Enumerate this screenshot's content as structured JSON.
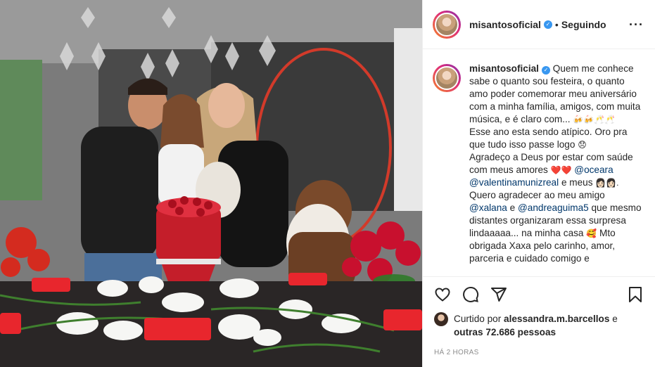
{
  "post": {
    "username": "misantosoficial",
    "follow_separator": "•",
    "follow_status": "Seguindo",
    "more_icon": "more-horizontal-icon",
    "verified_icon": "verified-badge-icon"
  },
  "caption": {
    "username": "misantosoficial",
    "line1": "Quem me conhece sabe o quanto sou festeira, o quanto amo poder comemorar meu aniversário com a minha família, amigos, com muita música, e é claro com...",
    "line1_emojis": "🍻🍻🥂🥂",
    "line2": "Esse ano esta sendo atípico. Oro pra que tudo isso passe logo",
    "line2_emoji": "😞",
    "line3_a": "Agradeço a Deus por estar com saúde com meus amores",
    "line3_emojis": "❤️❤️",
    "mention1": "@oceara",
    "mention2": "@valentinamunizreal",
    "line3_b": "e meus",
    "line3_emojis2": "👩🏻👩🏻.",
    "line4_a": "Quero agradecer ao meu amigo",
    "mention3": "@xalana",
    "line4_e": "e",
    "mention4": "@andreaguima5",
    "line4_b": "que mesmo distantes organizaram essa surpresa lindaaaaa... na minha casa",
    "line4_emoji": "🥰",
    "line5": "Mto obrigada Xaxa pelo carinho, amor, parceria e cuidado comigo e"
  },
  "actions": {
    "like_icon": "heart-icon",
    "comment_icon": "comment-icon",
    "share_icon": "share-icon",
    "save_icon": "bookmark-icon"
  },
  "likes": {
    "prefix": "Curtido por",
    "user": "alessandra.m.barcellos",
    "mid": "e",
    "others": "outras 72.686 pessoas"
  },
  "timestamp": "HÁ 2 HORAS",
  "colors": {
    "accent_link": "#00376b",
    "verified": "#3897f0",
    "muted": "#8e8e8e",
    "border": "#efefef"
  }
}
